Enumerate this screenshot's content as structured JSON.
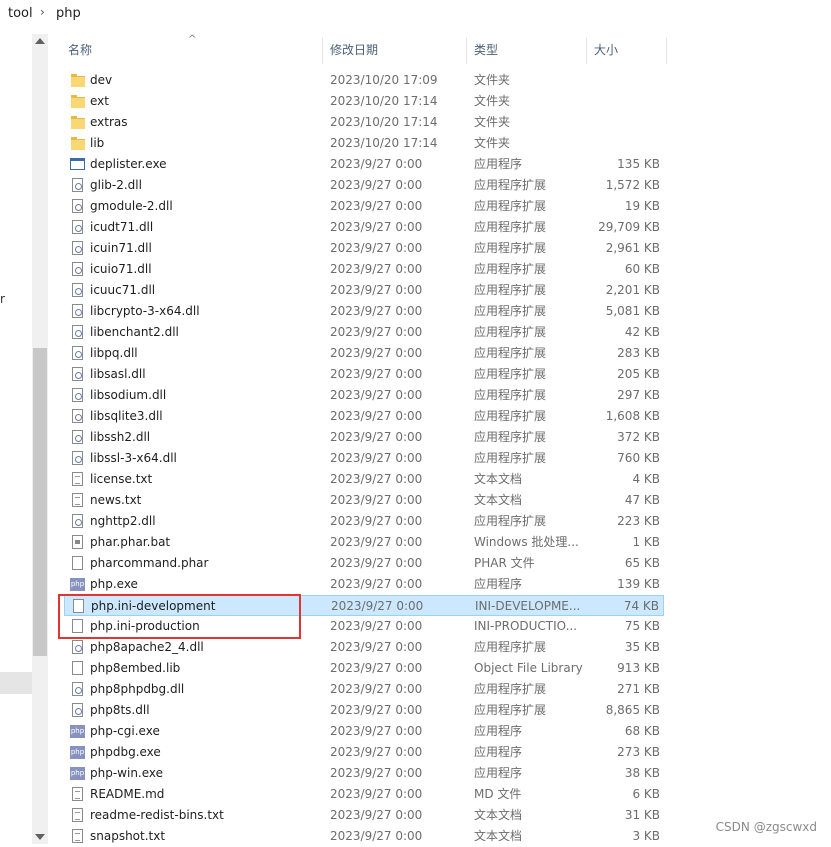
{
  "breadcrumb": {
    "items": [
      "tool",
      "php"
    ],
    "separator": "›"
  },
  "nav": {
    "fragment": "r"
  },
  "columns": {
    "name": "名称",
    "date": "修改日期",
    "type": "类型",
    "size": "大小"
  },
  "files": [
    {
      "name": "dev",
      "date": "2023/10/20 17:09",
      "type": "文件夹",
      "size": "",
      "icon": "folder-icon"
    },
    {
      "name": "ext",
      "date": "2023/10/20 17:14",
      "type": "文件夹",
      "size": "",
      "icon": "folder-icon"
    },
    {
      "name": "extras",
      "date": "2023/10/20 17:14",
      "type": "文件夹",
      "size": "",
      "icon": "folder-icon"
    },
    {
      "name": "lib",
      "date": "2023/10/20 17:14",
      "type": "文件夹",
      "size": "",
      "icon": "folder-icon"
    },
    {
      "name": "deplister.exe",
      "date": "2023/9/27 0:00",
      "type": "应用程序",
      "size": "135 KB",
      "icon": "exe-icon"
    },
    {
      "name": "glib-2.dll",
      "date": "2023/9/27 0:00",
      "type": "应用程序扩展",
      "size": "1,572 KB",
      "icon": "dll-icon"
    },
    {
      "name": "gmodule-2.dll",
      "date": "2023/9/27 0:00",
      "type": "应用程序扩展",
      "size": "19 KB",
      "icon": "dll-icon"
    },
    {
      "name": "icudt71.dll",
      "date": "2023/9/27 0:00",
      "type": "应用程序扩展",
      "size": "29,709 KB",
      "icon": "dll-icon"
    },
    {
      "name": "icuin71.dll",
      "date": "2023/9/27 0:00",
      "type": "应用程序扩展",
      "size": "2,961 KB",
      "icon": "dll-icon"
    },
    {
      "name": "icuio71.dll",
      "date": "2023/9/27 0:00",
      "type": "应用程序扩展",
      "size": "60 KB",
      "icon": "dll-icon"
    },
    {
      "name": "icuuc71.dll",
      "date": "2023/9/27 0:00",
      "type": "应用程序扩展",
      "size": "2,201 KB",
      "icon": "dll-icon"
    },
    {
      "name": "libcrypto-3-x64.dll",
      "date": "2023/9/27 0:00",
      "type": "应用程序扩展",
      "size": "5,081 KB",
      "icon": "dll-icon"
    },
    {
      "name": "libenchant2.dll",
      "date": "2023/9/27 0:00",
      "type": "应用程序扩展",
      "size": "42 KB",
      "icon": "dll-icon"
    },
    {
      "name": "libpq.dll",
      "date": "2023/9/27 0:00",
      "type": "应用程序扩展",
      "size": "283 KB",
      "icon": "dll-icon"
    },
    {
      "name": "libsasl.dll",
      "date": "2023/9/27 0:00",
      "type": "应用程序扩展",
      "size": "205 KB",
      "icon": "dll-icon"
    },
    {
      "name": "libsodium.dll",
      "date": "2023/9/27 0:00",
      "type": "应用程序扩展",
      "size": "297 KB",
      "icon": "dll-icon"
    },
    {
      "name": "libsqlite3.dll",
      "date": "2023/9/27 0:00",
      "type": "应用程序扩展",
      "size": "1,608 KB",
      "icon": "dll-icon"
    },
    {
      "name": "libssh2.dll",
      "date": "2023/9/27 0:00",
      "type": "应用程序扩展",
      "size": "372 KB",
      "icon": "dll-icon"
    },
    {
      "name": "libssl-3-x64.dll",
      "date": "2023/9/27 0:00",
      "type": "应用程序扩展",
      "size": "760 KB",
      "icon": "dll-icon"
    },
    {
      "name": "license.txt",
      "date": "2023/9/27 0:00",
      "type": "文本文档",
      "size": "4 KB",
      "icon": "text-file-icon"
    },
    {
      "name": "news.txt",
      "date": "2023/9/27 0:00",
      "type": "文本文档",
      "size": "47 KB",
      "icon": "text-file-icon"
    },
    {
      "name": "nghttp2.dll",
      "date": "2023/9/27 0:00",
      "type": "应用程序扩展",
      "size": "223 KB",
      "icon": "dll-icon"
    },
    {
      "name": "phar.phar.bat",
      "date": "2023/9/27 0:00",
      "type": "Windows 批处理...",
      "size": "1 KB",
      "icon": "batch-file-icon"
    },
    {
      "name": "pharcommand.phar",
      "date": "2023/9/27 0:00",
      "type": "PHAR 文件",
      "size": "65 KB",
      "icon": "file-icon"
    },
    {
      "name": "php.exe",
      "date": "2023/9/27 0:00",
      "type": "应用程序",
      "size": "139 KB",
      "icon": "php-icon"
    },
    {
      "name": "php.ini-development",
      "date": "2023/9/27 0:00",
      "type": "INI-DEVELOPME...",
      "size": "74 KB",
      "icon": "file-icon",
      "selected": true
    },
    {
      "name": "php.ini-production",
      "date": "2023/9/27 0:00",
      "type": "INI-PRODUCTIO...",
      "size": "75 KB",
      "icon": "file-icon"
    },
    {
      "name": "php8apache2_4.dll",
      "date": "2023/9/27 0:00",
      "type": "应用程序扩展",
      "size": "35 KB",
      "icon": "dll-icon"
    },
    {
      "name": "php8embed.lib",
      "date": "2023/9/27 0:00",
      "type": "Object File Library",
      "size": "913 KB",
      "icon": "file-icon"
    },
    {
      "name": "php8phpdbg.dll",
      "date": "2023/9/27 0:00",
      "type": "应用程序扩展",
      "size": "271 KB",
      "icon": "dll-icon"
    },
    {
      "name": "php8ts.dll",
      "date": "2023/9/27 0:00",
      "type": "应用程序扩展",
      "size": "8,865 KB",
      "icon": "dll-icon"
    },
    {
      "name": "php-cgi.exe",
      "date": "2023/9/27 0:00",
      "type": "应用程序",
      "size": "68 KB",
      "icon": "php-icon"
    },
    {
      "name": "phpdbg.exe",
      "date": "2023/9/27 0:00",
      "type": "应用程序",
      "size": "273 KB",
      "icon": "php-icon"
    },
    {
      "name": "php-win.exe",
      "date": "2023/9/27 0:00",
      "type": "应用程序",
      "size": "38 KB",
      "icon": "php-icon"
    },
    {
      "name": "README.md",
      "date": "2023/9/27 0:00",
      "type": "MD 文件",
      "size": "6 KB",
      "icon": "text-file-icon"
    },
    {
      "name": "readme-redist-bins.txt",
      "date": "2023/9/27 0:00",
      "type": "文本文档",
      "size": "31 KB",
      "icon": "text-file-icon"
    },
    {
      "name": "snapshot.txt",
      "date": "2023/9/27 0:00",
      "type": "文本文档",
      "size": "3 KB",
      "icon": "text-file-icon"
    }
  ],
  "watermark": "CSDN @zgscwxd",
  "colors": {
    "selection": "#cce8ff",
    "highlight_border": "#e03535",
    "header_text": "#4c607a"
  }
}
